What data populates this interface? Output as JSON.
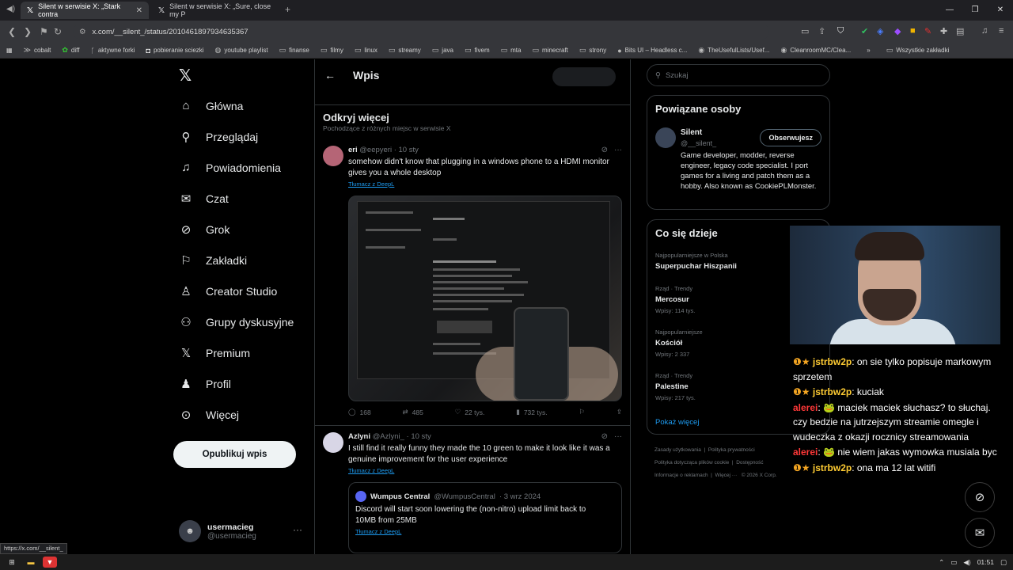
{
  "browser": {
    "tabs": [
      {
        "title": "Silent w serwisie X: „Stark contra",
        "active": true
      },
      {
        "title": "Silent w serwisie X: „Sure, close my P",
        "active": false
      }
    ],
    "url": "x.com/__silent_/status/2010461897934635367",
    "bookmarks": [
      "cobalt",
      "diff",
      "aktywne forki",
      "pobieranie sciezki",
      "youtube playlist",
      "finanse",
      "filmy",
      "linux",
      "streamy",
      "java",
      "fivem",
      "mta",
      "minecraft",
      "strony",
      "Bits UI – Headless c...",
      "TheUsefulLists/Usef...",
      "CleanroomMC/Clea..."
    ],
    "bookmarks_more": "»",
    "bookmarks_all": "Wszystkie zakładki",
    "status_url": "https://x.com/__silent_"
  },
  "nav": {
    "items": [
      "Główna",
      "Przeglądaj",
      "Powiadomienia",
      "Czat",
      "Grok",
      "Zakładki",
      "Creator Studio",
      "Grupy dyskusyjne",
      "Premium",
      "Profil",
      "Więcej"
    ],
    "post_button": "Opublikuj wpis",
    "user_name": "usermacieg",
    "user_handle": "@usermacieg"
  },
  "center": {
    "title": "Wpis",
    "discover_title": "Odkryj więcej",
    "discover_sub": "Pochodzące z różnych miejsc w serwisie X",
    "tweets": [
      {
        "name": "eri",
        "handle": "@eepyeri",
        "time": "· 10 sty",
        "text": "somehow didn't know that plugging in a windows phone to a HDMI monitor gives you a whole desktop",
        "translate": "Tłumacz z DeepL",
        "stats": {
          "replies": "168",
          "reposts": "485",
          "likes": "22 tys.",
          "views": "732 tys."
        }
      },
      {
        "name": "Azlyni",
        "handle": "@Azlyni_",
        "time": "· 10 sty",
        "text": "I still find it really funny they made the 10 green to make it look like it was a genuine improvement for the user experience",
        "translate": "Tłumacz z DeepL",
        "quote": {
          "name": "Wumpus Central",
          "handle": "@WumpusCentral",
          "time": "· 3 wrz 2024",
          "text": "Discord will start soon lowering the (non-nitro) upload limit back to 10MB from 25MB",
          "translate": "Tłumacz z DeepL"
        }
      }
    ]
  },
  "right": {
    "search_placeholder": "Szukaj",
    "related_title": "Powiązane osoby",
    "related": {
      "name": "Silent",
      "handle": "@__silent_",
      "button": "Obserwujesz",
      "bio": "Game developer, modder, reverse engineer, legacy code specialist. I port games for a living and patch them as a hobby. Also known as CookiePLMonster."
    },
    "trends_title": "Co się dzieje",
    "trends": [
      {
        "meta": "Najpopularniejsze w Polska",
        "name": "Superpuchar Hiszpanii",
        "count": ""
      },
      {
        "meta": "Rząd · Trendy",
        "name": "Mercosur",
        "count": "Wpisy: 114 tys."
      },
      {
        "meta": "Najpopularniejsze",
        "name": "Kościół",
        "count": "Wpisy: 2 337"
      },
      {
        "meta": "Rząd · Trendy",
        "name": "Palestine",
        "count": "Wpisy: 217 tys."
      }
    ],
    "show_more": "Pokaż więcej",
    "footer": [
      "Zasady użytkowania",
      "Polityka prywatności",
      "Polityka dotycząca plików cookie",
      "Dostępność",
      "Informacje o reklamach",
      "Więcej ···",
      "© 2026 X Corp."
    ]
  },
  "chat": [
    {
      "user": "jstrbw2p",
      "color_class": "u1",
      "text": "on sie tylko popisuje markowym sprzetem"
    },
    {
      "user": "jstrbw2p",
      "color_class": "u1",
      "text": "kuciak"
    },
    {
      "user": "alerei",
      "color_class": "u2",
      "text": "maciek maciek słuchasz? to słuchaj. czy bedzie na jutrzejszym streamie omegle i wudeczka z okazji rocznicy streamowania"
    },
    {
      "user": "alerei",
      "color_class": "u2",
      "text": "nie wiem jakas wymowka musiala byc"
    },
    {
      "user": "jstrbw2p",
      "color_class": "u1",
      "text": "ona ma 12 lat witifi"
    }
  ],
  "taskbar": {
    "time": "01:51"
  },
  "colors": {
    "accent": "#1d9bf0",
    "bg": "#000000",
    "border": "#2f3336"
  }
}
